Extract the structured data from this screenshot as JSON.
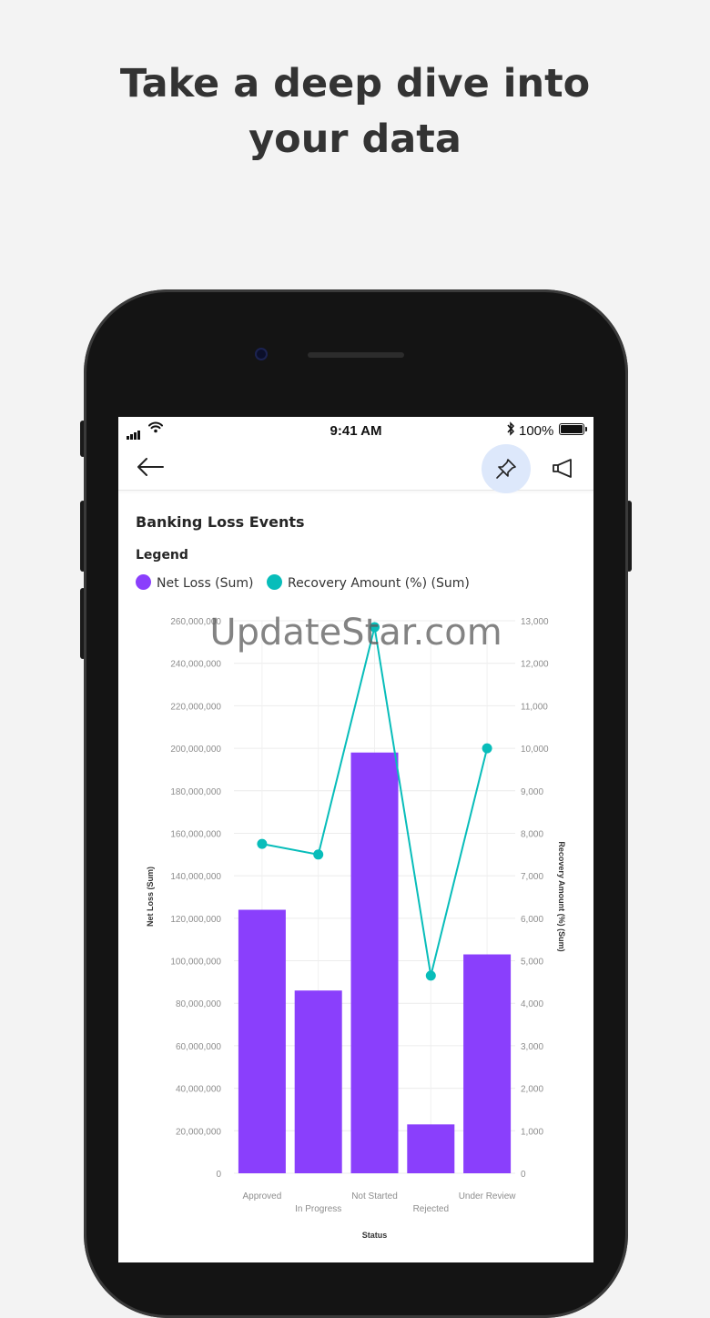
{
  "headline": {
    "line1": "Take a deep dive into",
    "line2": "your data"
  },
  "status_bar": {
    "time": "9:41 AM",
    "battery": "100%"
  },
  "toolbar": {
    "back_icon": "arrow-left-icon",
    "pin_icon": "pin-icon",
    "announce_icon": "megaphone-icon",
    "pin_active_color": "#dde8fb"
  },
  "card": {
    "title": "Banking Loss Events",
    "legend_title": "Legend"
  },
  "watermark": "UpdateStar.com",
  "chart_data": {
    "type": "bar",
    "categories": [
      "Approved",
      "In Progress",
      "Not Started",
      "Rejected",
      "Under Review"
    ],
    "series": [
      {
        "name": "Net Loss (Sum)",
        "type": "bar",
        "axis": "left",
        "color": "#8a3ffc",
        "values": [
          124000000,
          86000000,
          198000000,
          23000000,
          103000000
        ]
      },
      {
        "name": "Recovery Amount (%) (Sum)",
        "type": "line",
        "axis": "right",
        "color": "#08bdba",
        "values": [
          7750,
          7500,
          12850,
          4650,
          10000
        ]
      }
    ],
    "xlabel": "Status",
    "ylabel": "Net Loss (Sum)",
    "y2label": "Recovery Amount (%) (Sum)",
    "ylim": [
      0,
      260000000
    ],
    "y2lim": [
      0,
      13000
    ],
    "yticks": [
      "0",
      "20,000,000",
      "40,000,000",
      "60,000,000",
      "80,000,000",
      "100,000,000",
      "120,000,000",
      "140,000,000",
      "160,000,000",
      "180,000,000",
      "200,000,000",
      "220,000,000",
      "240,000,000",
      "260,000,000"
    ],
    "y2ticks": [
      "0",
      "1,000",
      "2,000",
      "3,000",
      "4,000",
      "5,000",
      "6,000",
      "7,000",
      "8,000",
      "9,000",
      "10,000",
      "11,000",
      "12,000",
      "13,000"
    ],
    "grid": true
  }
}
